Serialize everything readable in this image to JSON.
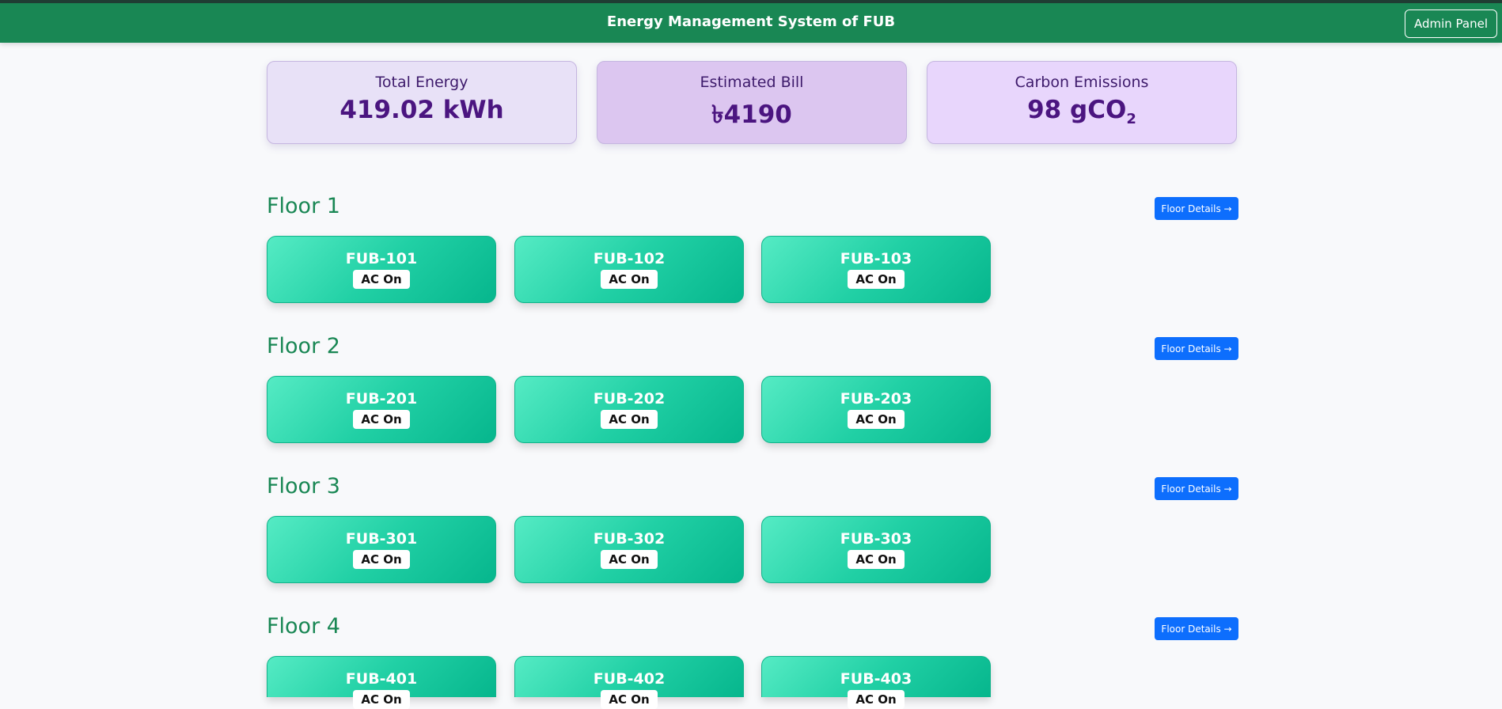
{
  "header": {
    "title": "Energy Management System of FUB",
    "admin_label": "Admin Panel"
  },
  "stats": [
    {
      "label": "Total Energy",
      "value": "419.02 kWh"
    },
    {
      "label": "Estimated Bill",
      "value": "৳4190"
    },
    {
      "label": "Carbon Emissions",
      "value_main": "98 gCO",
      "value_sub": "2"
    }
  ],
  "floors": [
    {
      "title": "Floor 1",
      "button": "Floor Details →",
      "rooms": [
        {
          "name": "FUB-101",
          "status": "AC On"
        },
        {
          "name": "FUB-102",
          "status": "AC On"
        },
        {
          "name": "FUB-103",
          "status": "AC On"
        }
      ]
    },
    {
      "title": "Floor 2",
      "button": "Floor Details →",
      "rooms": [
        {
          "name": "FUB-201",
          "status": "AC On"
        },
        {
          "name": "FUB-202",
          "status": "AC On"
        },
        {
          "name": "FUB-203",
          "status": "AC On"
        }
      ]
    },
    {
      "title": "Floor 3",
      "button": "Floor Details →",
      "rooms": [
        {
          "name": "FUB-301",
          "status": "AC On"
        },
        {
          "name": "FUB-302",
          "status": "AC On"
        },
        {
          "name": "FUB-303",
          "status": "AC On"
        }
      ]
    },
    {
      "title": "Floor 4",
      "button": "Floor Details →",
      "rooms": [
        {
          "name": "FUB-401",
          "status": "AC On"
        },
        {
          "name": "FUB-402",
          "status": "AC On"
        },
        {
          "name": "FUB-403",
          "status": "AC On"
        }
      ]
    }
  ],
  "colors": {
    "header_bg": "#198754",
    "floor_title": "#198754",
    "button_blue": "#0d6efd",
    "stat_bg_1": "#e8e1f7",
    "stat_bg_2": "#dcc6f0",
    "stat_bg_3": "#e8d6fc",
    "room_gradient_start": "#55ebc4",
    "room_gradient_end": "#06b68d"
  }
}
